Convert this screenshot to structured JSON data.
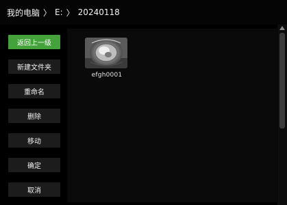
{
  "breadcrumb": {
    "root": "我的电脑",
    "separator": "〉",
    "drive": "E:",
    "folder": "20240118"
  },
  "sidebar": {
    "back": "返回上一级",
    "new_folder": "新建文件夹",
    "rename": "重命名",
    "delete": "删除",
    "move": "移动",
    "confirm": "确定",
    "cancel": "取消"
  },
  "files": [
    {
      "name": "efgh0001",
      "icon": "image-thumbnail-icon"
    }
  ],
  "colors": {
    "accent": "#44a23a",
    "background": "#000000",
    "button": "#1c1c1c"
  }
}
